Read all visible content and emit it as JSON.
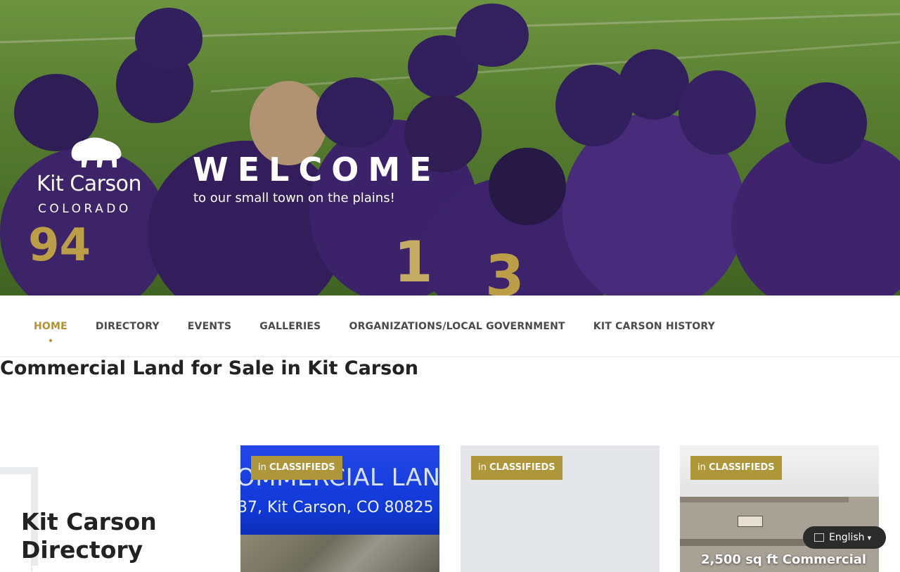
{
  "hero": {
    "brand_name": "Kit Carson",
    "brand_state": "COLORADO",
    "welcome": "WELCOME",
    "tagline": "to our small town on the plains!",
    "logo_icon": "bison-icon"
  },
  "nav": {
    "items": [
      {
        "label": "HOME",
        "active": true
      },
      {
        "label": "DIRECTORY",
        "active": false
      },
      {
        "label": "EVENTS",
        "active": false
      },
      {
        "label": "GALLERIES",
        "active": false
      },
      {
        "label": "ORGANIZATIONS/LOCAL GOVERNMENT",
        "active": false
      },
      {
        "label": "KIT CARSON HISTORY",
        "active": false
      }
    ],
    "active_color": "#b38f32"
  },
  "page": {
    "title": "Commercial Land for Sale in Kit Carson"
  },
  "sidebar": {
    "directory_title": "Kit Carson Directory"
  },
  "cards": [
    {
      "badge_prefix": "in",
      "badge_category": "CLASSIFIEDS",
      "image_text_line1": "OMMERCIAL LAN",
      "image_text_line2": "37, Kit Carson, CO  80825"
    },
    {
      "badge_prefix": "in",
      "badge_category": "CLASSIFIEDS"
    },
    {
      "badge_prefix": "in",
      "badge_category": "CLASSIFIEDS",
      "caption": "2,500 sq ft Commercial"
    }
  ],
  "badge_color": "#ad973a",
  "language": {
    "label": "English",
    "caret": "▾",
    "flag_icon": "flag-icon"
  }
}
